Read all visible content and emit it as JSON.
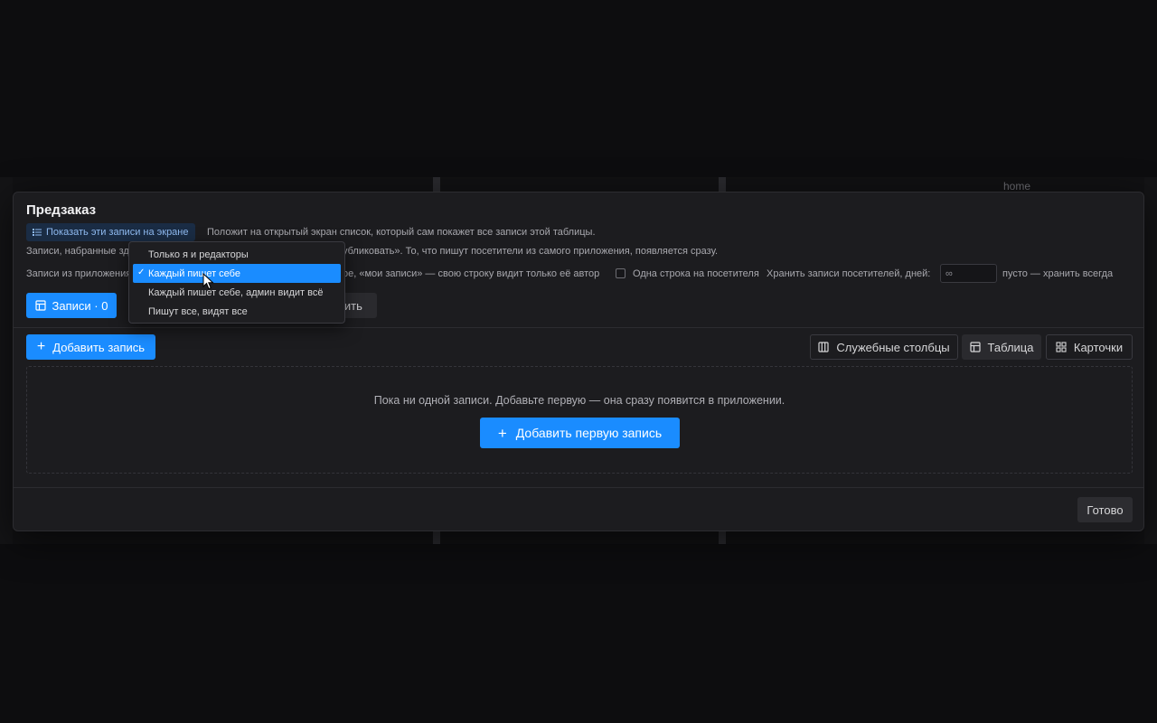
{
  "background": {
    "home_label": "home"
  },
  "modal": {
    "title": "Предзаказ",
    "show_button_label": "Показать эти записи на экране",
    "show_button_desc": "Положит на открытый экран список, который сам покажет все записи этой таблицы.",
    "line2_start": "Записи, набранные зд",
    "line2_end": "убликовать». То, что пишут посетители из самого приложения, появляется сразу.",
    "line3_start": "Записи из приложения",
    "line3_mid": "ое, «мои записи» — свою строку видит только её автор",
    "one_row_label": "Одна строка на посетителя",
    "keep_days_label": "Хранить записи посетителей, дней:",
    "keep_days_placeholder": "∞",
    "keep_days_hint": "пусто — хранить всегда",
    "tab_records_label": "Записи · 0",
    "tab_second_label": "вить",
    "add_record_label": "Добавить запись",
    "service_columns_label": "Служебные столбцы",
    "table_view_label": "Таблица",
    "cards_view_label": "Карточки",
    "empty_text": "Пока ни одной записи. Добавьте первую — она сразу появится в приложении.",
    "add_first_label": "Добавить первую запись",
    "done_label": "Готово"
  },
  "dropdown": {
    "items": [
      {
        "label": "Только я и редакторы"
      },
      {
        "label": "Каждый пишет себе"
      },
      {
        "label": "Каждый пишет себе, админ видит всё"
      },
      {
        "label": "Пишут все, видят все"
      }
    ],
    "selected_index": 1,
    "check_glyph": "✓"
  },
  "colors": {
    "accent": "#1a8cff",
    "modal_bg": "#1c1c1f",
    "page_bg": "#0d0d0f"
  }
}
